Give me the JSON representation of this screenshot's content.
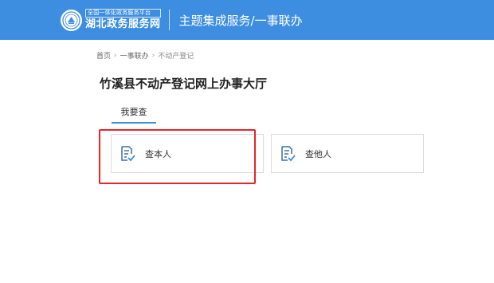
{
  "header": {
    "logo_small_text": "全国一体化政务服务平台",
    "logo_big_text": "湖北政务服务网",
    "section_title": "主题集成服务/一事联办",
    "background_color": "#3d8ee0"
  },
  "breadcrumb": {
    "items": [
      "首页",
      "一事联办",
      "不动产登记"
    ],
    "separator": "›"
  },
  "page_title": "竹溪县不动产登记网上办事大厅",
  "tabs": [
    {
      "label": "我要查",
      "active": true
    }
  ],
  "cards": [
    {
      "label": "查本人",
      "icon": "document-check-icon",
      "highlighted": true
    },
    {
      "label": "查他人",
      "icon": "document-check-icon",
      "highlighted": false
    }
  ],
  "colors": {
    "accent": "#3d8ee0",
    "highlight": "#e8242a"
  }
}
